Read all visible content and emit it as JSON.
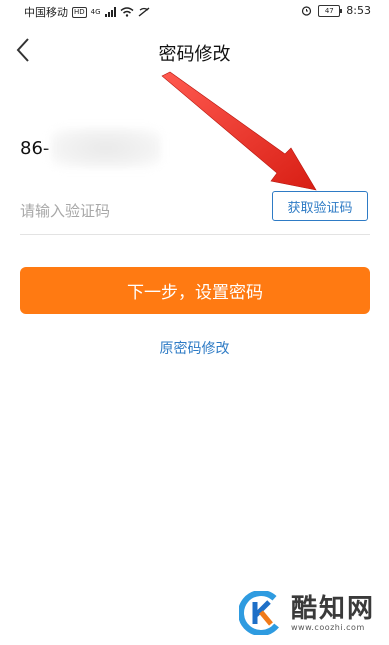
{
  "status_bar": {
    "carrier": "中国移动",
    "hd_badge": "HD",
    "network": "4G",
    "battery": "47",
    "time": "8:53"
  },
  "nav": {
    "title": "密码修改"
  },
  "phone": {
    "prefix": "86-"
  },
  "code": {
    "placeholder": "请输入验证码",
    "value": "",
    "get_code_label": "获取验证码"
  },
  "actions": {
    "next_label": "下一步，设置密码",
    "old_password_label": "原密码修改"
  },
  "colors": {
    "primary_orange": "#ff7a12",
    "link_blue": "#2e7bc5",
    "annotation_red": "#e8281e"
  },
  "watermark": {
    "name": "酷知网",
    "url": "www.coozhi.com"
  }
}
